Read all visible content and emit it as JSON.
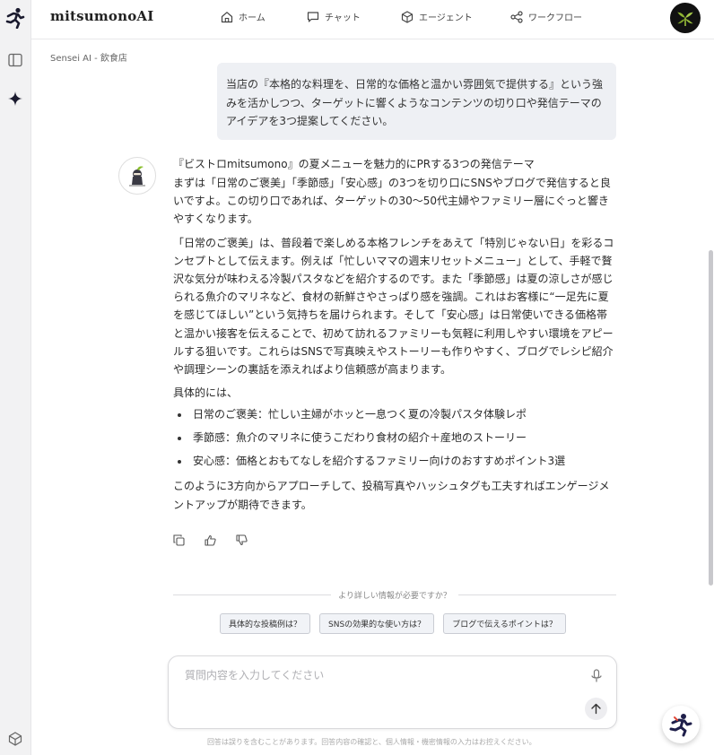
{
  "app": {
    "brand": "mitsumonoAI"
  },
  "nav": [
    {
      "label": "ホーム",
      "icon": "home-icon"
    },
    {
      "label": "チャット",
      "icon": "chat-icon"
    },
    {
      "label": "エージェント",
      "icon": "cube-icon"
    },
    {
      "label": "ワークフロー",
      "icon": "workflow-icon"
    }
  ],
  "breadcrumb": "Sensei AI - 飲食店",
  "user_message": "当店の『本格的な料理を、日常的な価格と温かい雰囲気で提供する』という強みを活かしつつ、ターゲットに響くようなコンテンツの切り口や発信テーマのアイデアを3つ提案してください。",
  "answer": {
    "title": "『ビストロmitsumono』の夏メニューを魅力的にPRする3つの発信テーマ",
    "p1": "まずは「日常のご褒美」「季節感」「安心感」の3つを切り口にSNSやブログで発信すると良いですよ。この切り口であれば、ターゲットの30〜50代主婦やファミリー層にぐっと響きやすくなります。",
    "p2": "「日常のご褒美」は、普段着で楽しめる本格フレンチをあえて「特別じゃない日」を彩るコンセプトとして伝えます。例えば「忙しいママの週末リセットメニュー」として、手軽で贅沢な気分が味わえる冷製パスタなどを紹介するのです。また「季節感」は夏の涼しさが感じられる魚介のマリネなど、食材の新鮮さやさっぱり感を強調。これはお客様に“一足先に夏を感じてほしい”という気持ちを届けられます。そして「安心感」は日常使いできる価格帯と温かい接客を伝えることで、初めて訪れるファミリーも気軽に利用しやすい環境をアピールする狙いです。これらはSNSで写真映えやストーリーも作りやすく、ブログでレシピ紹介や調理シーンの裏話を添えればより信頼感が高まります。",
    "intro": "具体的には、",
    "bullets": [
      "日常のご褒美：忙しい主婦がホッと一息つく夏の冷製パスタ体験レポ",
      "季節感：魚介のマリネに使うこだわり食材の紹介＋産地のストーリー",
      "安心感：価格とおもてなしを紹介するファミリー向けのおすすめポイント3選"
    ],
    "conclusion": "このように3方向からアプローチして、投稿写真やハッシュタグも工夫すればエンゲージメントアップが期待できます。"
  },
  "suggestions": {
    "label": "より詳しい情報が必要ですか？",
    "chips": [
      "具体的な投稿例は？",
      "SNSの効果的な使い方は？",
      "ブログで伝えるポイントは？"
    ]
  },
  "input": {
    "placeholder": "質問内容を入力してください",
    "value": ""
  },
  "disclaimer": "回答は誤りを含むことがあります。回答内容の確認と、個人情報・機密情報の入力はお控えください。",
  "colors": {
    "accent": "#1f1f3a",
    "bubble": "#eef0f4",
    "chip_bg": "#f1f3f7",
    "chip_border": "#c9ccd3"
  }
}
